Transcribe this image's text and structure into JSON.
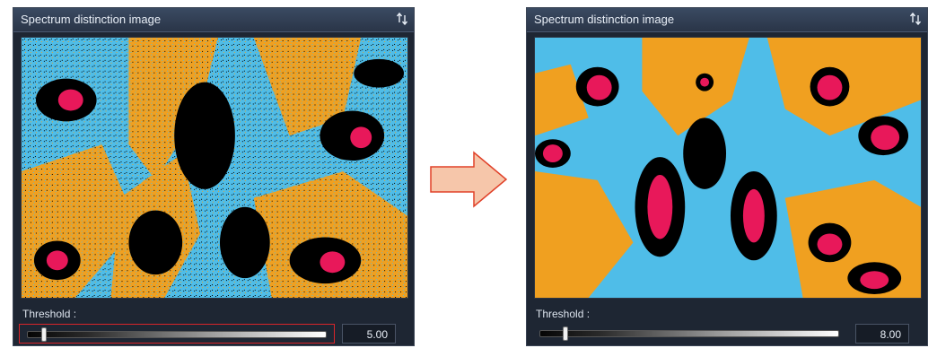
{
  "colors": {
    "panel_bg": "#1e2633",
    "title_bar": "#324058",
    "cyan": "#4fbde8",
    "orange": "#f0a020",
    "black": "#000000",
    "magenta": "#e8185a",
    "arrow_fill": "#f6c6aa",
    "arrow_stroke": "#e04028",
    "highlight": "#d9252a"
  },
  "icons": {
    "sort": "sort-up-down-icon",
    "arrow": "right-arrow"
  },
  "left_panel": {
    "title": "Spectrum distinction image",
    "threshold_label": "Threshold :",
    "threshold_value": "5.00",
    "slider_fraction": 0.05,
    "slider_highlighted": true
  },
  "right_panel": {
    "title": "Spectrum distinction image",
    "threshold_label": "Threshold :",
    "threshold_value": "8.00",
    "slider_fraction": 0.08,
    "slider_highlighted": false
  }
}
